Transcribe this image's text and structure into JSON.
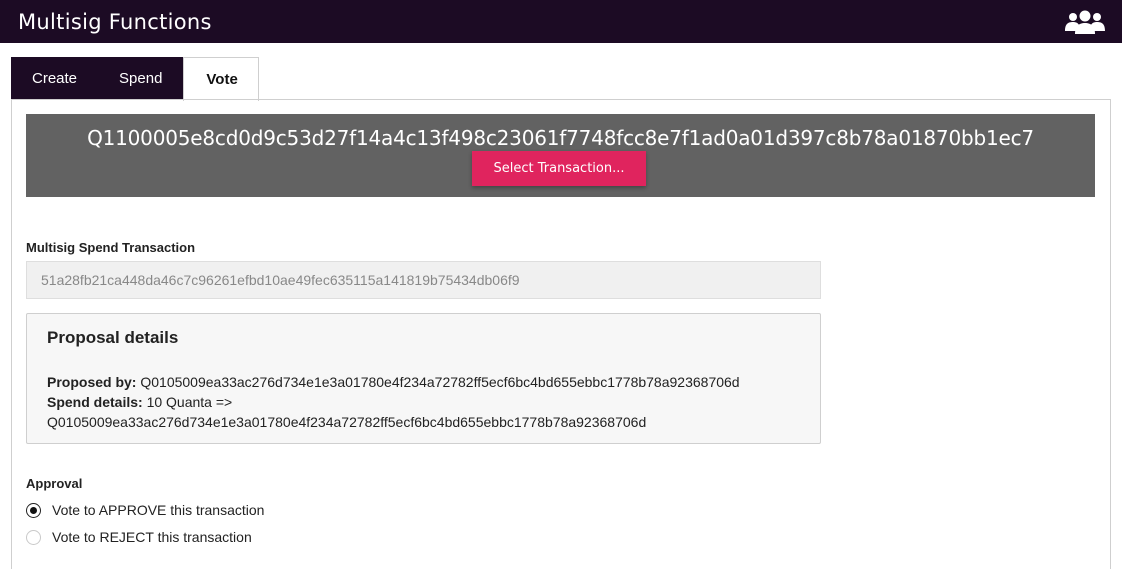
{
  "header": {
    "title": "Multisig Functions",
    "icon": "users-group-icon"
  },
  "tabs": [
    {
      "label": "Create",
      "active": false
    },
    {
      "label": "Spend",
      "active": false
    },
    {
      "label": "Vote",
      "active": true
    }
  ],
  "address": {
    "value": "Q1100005e8cd0d9c53d27f14a4c13f498c23061f7748fcc8e7f1ad0a01d397c8b78a01870bb1ec7",
    "select_button_label": "Select Transaction..."
  },
  "spend_transaction": {
    "label": "Multisig Spend Transaction",
    "value": "51a28fb21ca448da46c7c96261efbd10ae49fec635115a141819b75434db06f9"
  },
  "proposal": {
    "title": "Proposal details",
    "proposed_by_label": "Proposed by:",
    "proposed_by_value": "Q0105009ea33ac276d734e1e3a01780e4f234a72782ff5ecf6bc4bd655ebbc1778b78a92368706d",
    "spend_details_label": "Spend details:",
    "spend_details_value": "10 Quanta =>",
    "spend_details_address": "Q0105009ea33ac276d734e1e3a01780e4f234a72782ff5ecf6bc4bd655ebbc1778b78a92368706d"
  },
  "approval": {
    "label": "Approval",
    "options": [
      {
        "label": "Vote to APPROVE this transaction",
        "checked": true
      },
      {
        "label": "Vote to REJECT this transaction",
        "checked": false
      }
    ]
  },
  "colors": {
    "header_bg": "#1c0b24",
    "address_bg": "#626262",
    "accent": "#e0245e"
  }
}
